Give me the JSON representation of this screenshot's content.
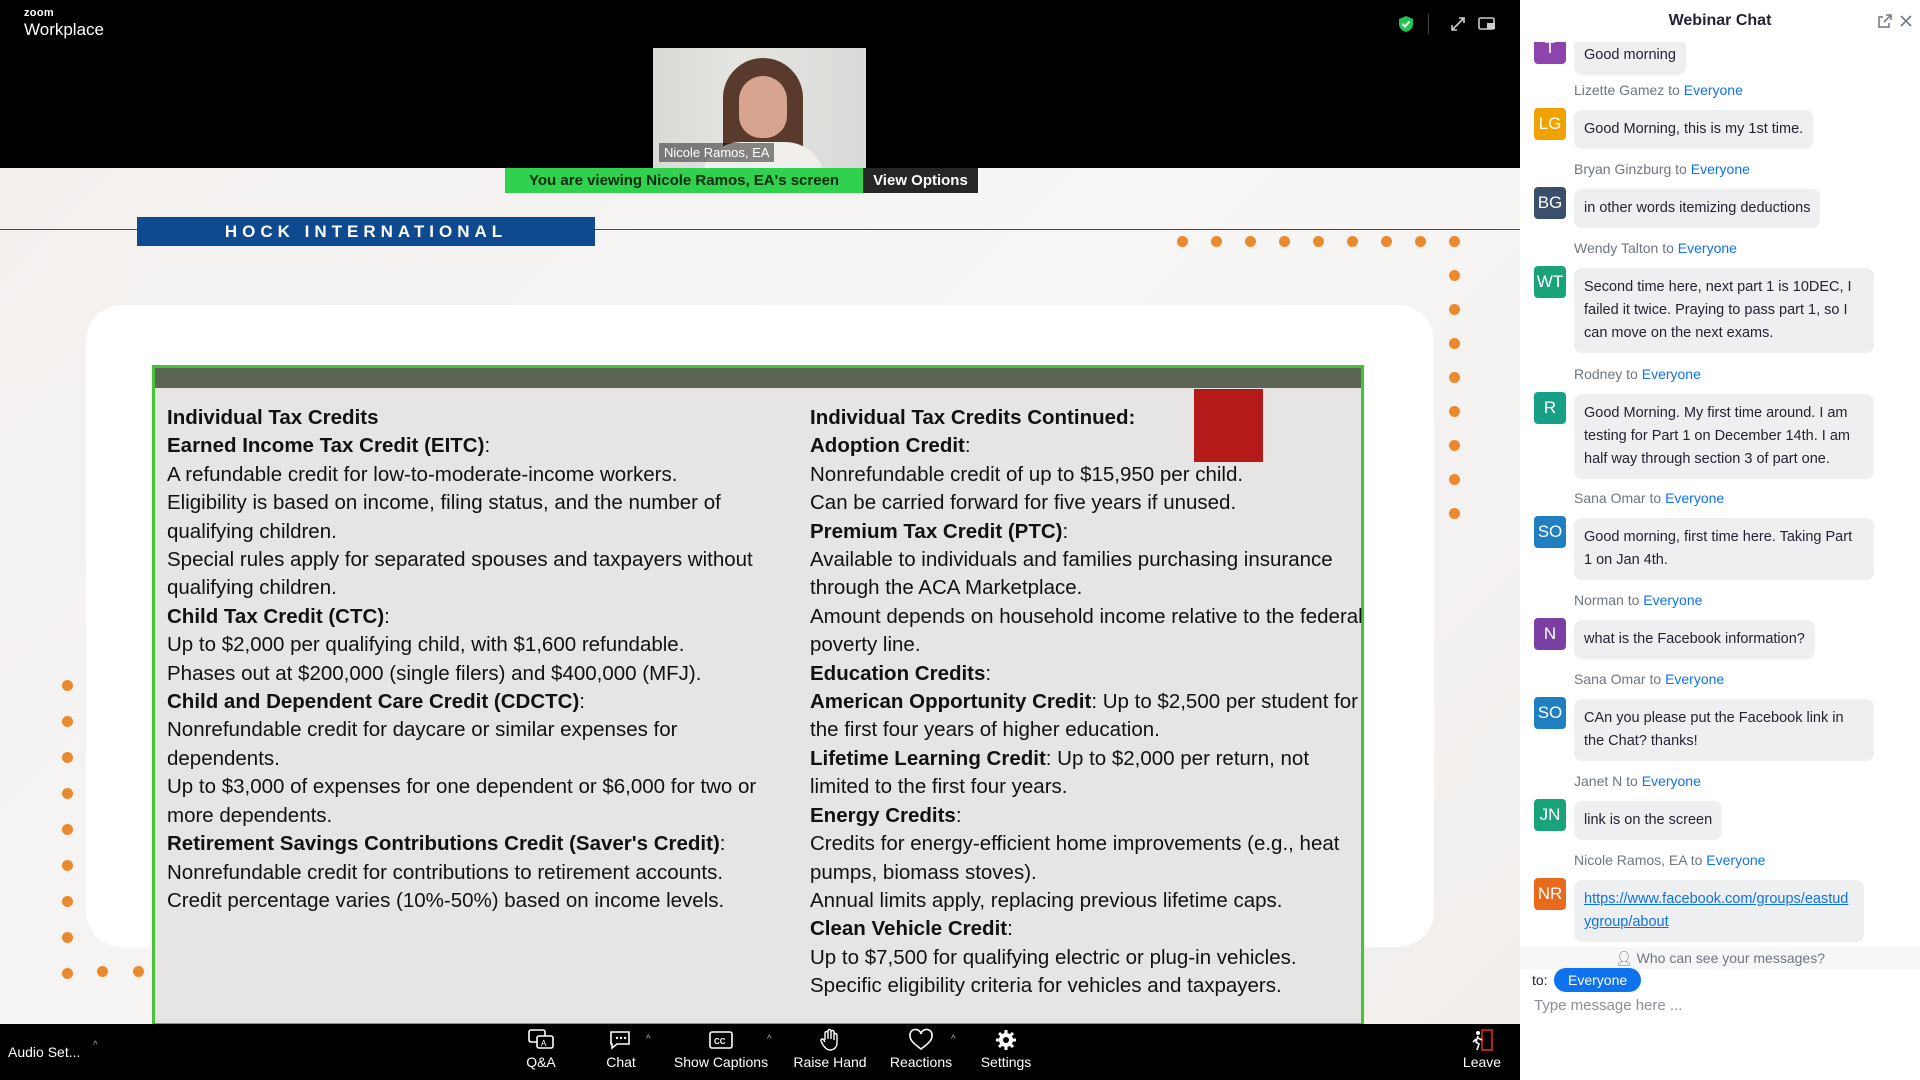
{
  "app": {
    "logo_top": "zoom",
    "logo_bottom": "Workplace"
  },
  "speaker": {
    "name": "Nicole Ramos, EA"
  },
  "share_banner": {
    "viewing": "You are viewing  Nicole Ramos, EA's screen",
    "view_options": "View Options"
  },
  "slide": {
    "header": "HOCK INTERNATIONAL",
    "left": [
      {
        "b": "Individual Tax Credits",
        "t": ""
      },
      {
        "b": "Earned Income Tax Credit (EITC)",
        "t": ":"
      },
      {
        "b": "",
        "t": "A refundable credit for low-to-moderate-income workers."
      },
      {
        "b": "",
        "t": "Eligibility is based on income, filing status, and the number of qualifying children."
      },
      {
        "b": "",
        "t": "Special rules apply for separated spouses and taxpayers without qualifying children."
      },
      {
        "b": "Child Tax Credit (CTC)",
        "t": ":"
      },
      {
        "b": "",
        "t": "Up to $2,000 per qualifying child, with $1,600 refundable."
      },
      {
        "b": "",
        "t": "Phases out at $200,000 (single filers) and $400,000 (MFJ)."
      },
      {
        "b": "Child and Dependent Care Credit (CDCTC)",
        "t": ":"
      },
      {
        "b": "",
        "t": "Nonrefundable credit for daycare or similar expenses for dependents."
      },
      {
        "b": "",
        "t": "Up to $3,000 of expenses for one dependent or $6,000 for two or more dependents."
      },
      {
        "b": "Retirement Savings Contributions Credit (Saver's Credit)",
        "t": ":"
      },
      {
        "b": "",
        "t": "Nonrefundable credit for contributions to retirement accounts."
      },
      {
        "b": "",
        "t": "Credit percentage varies (10%-50%) based on income levels."
      }
    ],
    "right": [
      {
        "b": "Individual Tax Credits Continued:",
        "t": ""
      },
      {
        "b": "Adoption Credit",
        "t": ":"
      },
      {
        "b": "",
        "t": "Nonrefundable credit of up to $15,950 per child."
      },
      {
        "b": "",
        "t": "Can be carried forward for five years if unused."
      },
      {
        "b": "Premium Tax Credit (PTC)",
        "t": ":"
      },
      {
        "b": "",
        "t": "Available to individuals and families purchasing insurance through the ACA Marketplace."
      },
      {
        "b": "",
        "t": "Amount depends on household income relative to the federal poverty line."
      },
      {
        "b": "Education Credits",
        "t": ":"
      },
      {
        "b": "American Opportunity Credit",
        "t": ": Up to $2,500 per student for the first four years of higher education."
      },
      {
        "b": "Lifetime Learning Credit",
        "t": ": Up to $2,000 per return, not limited to the first four years."
      },
      {
        "b": "Energy Credits",
        "t": ":"
      },
      {
        "b": "",
        "t": "Credits for energy-efficient home improvements (e.g., heat pumps, biomass stoves)."
      },
      {
        "b": "",
        "t": "Annual limits apply, replacing previous lifetime caps."
      },
      {
        "b": "Clean Vehicle Credit",
        "t": ":"
      },
      {
        "b": "",
        "t": "Up to $7,500 for qualifying electric or plug-in vehicles."
      },
      {
        "b": "",
        "t": "Specific eligibility criteria for vehicles and taxpayers."
      }
    ]
  },
  "toolbar": {
    "audio": "Audio Set...",
    "qa": "Q&A",
    "chat": "Chat",
    "captions": "Show Captions",
    "raise_hand": "Raise Hand",
    "reactions": "Reactions",
    "settings": "Settings",
    "leave": "Leave"
  },
  "chat": {
    "title": "Webinar Chat",
    "to_word": "to",
    "messages": [
      {
        "sender": "",
        "recipient": "",
        "initials": "T",
        "color": "#8e44ad",
        "text": "Good morning"
      },
      {
        "sender": "Lizette Gamez",
        "recipient": "Everyone",
        "initials": "LG",
        "color": "#f0a202",
        "text": "Good Morning, this is my 1st time."
      },
      {
        "sender": "Bryan Ginzburg",
        "recipient": "Everyone",
        "initials": "BG",
        "color": "#3a4f6a",
        "text": "in other words itemizing deductions"
      },
      {
        "sender": "Wendy Talton",
        "recipient": "Everyone",
        "initials": "WT",
        "color": "#1aa37a",
        "text": "Second time here, next part 1 is 10DEC, I failed it twice. Praying to pass part 1, so I can move on the next exams."
      },
      {
        "sender": "Rodney",
        "recipient": "Everyone",
        "initials": "R",
        "color": "#17a085",
        "text": "Good Morning. My first time around. I am testing for Part 1 on December 14th. I am half way through section 3 of part one."
      },
      {
        "sender": "Sana Omar",
        "recipient": "Everyone",
        "initials": "SO",
        "color": "#1f7fc0",
        "text": "Good morning, first time here. Taking Part 1 on Jan 4th."
      },
      {
        "sender": "Norman",
        "recipient": "Everyone",
        "initials": "N",
        "color": "#7b3fa3",
        "text": "what is the Facebook information?"
      },
      {
        "sender": "Sana Omar",
        "recipient": "Everyone",
        "initials": "SO",
        "color": "#1f7fc0",
        "text": "CAn you please put the Facebook link in the Chat? thanks!"
      },
      {
        "sender": "Janet N",
        "recipient": "Everyone",
        "initials": "JN",
        "color": "#1aa37a",
        "text": "link is on the screen"
      },
      {
        "sender": "Nicole Ramos, EA",
        "recipient": "Everyone",
        "initials": "NR",
        "color": "#e86a1c",
        "text": "https://www.facebook.com/groups/eastudygroup/about"
      }
    ],
    "who_can_see": "Who can see your messages?",
    "to_label": "to:",
    "to_value": "Everyone",
    "input_placeholder": "Type message here ..."
  }
}
